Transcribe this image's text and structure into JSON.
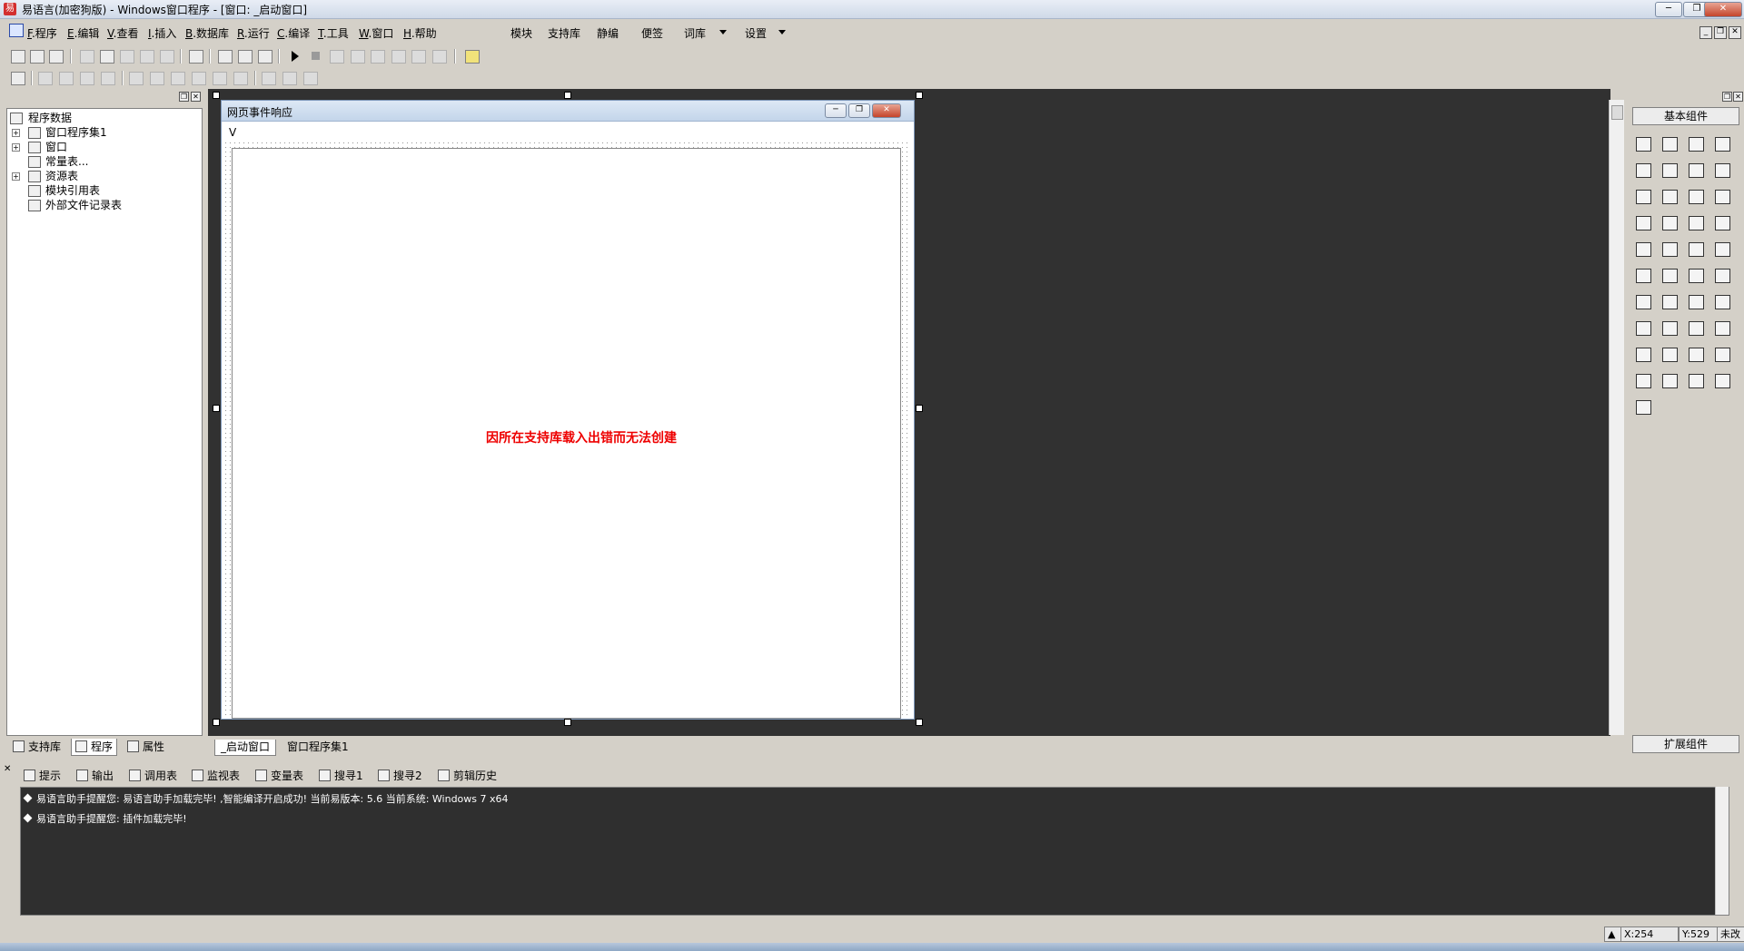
{
  "window": {
    "title": "易语言(加密狗版) - Windows窗口程序 - [窗口: _启动窗口]",
    "controls": [
      "─",
      "❐",
      "✕"
    ]
  },
  "menu": {
    "items": [
      {
        "key": "F",
        "label": ".程序"
      },
      {
        "key": "E",
        "label": ".编辑"
      },
      {
        "key": "V",
        "label": ".查看"
      },
      {
        "key": "I",
        "label": ".插入"
      },
      {
        "key": "B",
        "label": ".数据库"
      },
      {
        "key": "R",
        "label": ".运行"
      },
      {
        "key": "C",
        "label": ".编译"
      },
      {
        "key": "T",
        "label": ".工具"
      },
      {
        "key": "W",
        "label": ".窗口"
      },
      {
        "key": "H",
        "label": ".帮助"
      }
    ],
    "extras": [
      "模块",
      "支持库",
      "静编",
      "便签",
      "词库",
      "设置"
    ]
  },
  "left_panel": {
    "tree": [
      {
        "label": "程序数据",
        "icon": "database-icon",
        "expander": false,
        "indent": 0
      },
      {
        "label": "窗口程序集1",
        "icon": "module-icon",
        "expander": true,
        "indent": 1
      },
      {
        "label": "窗口",
        "icon": "window-icon",
        "expander": true,
        "indent": 1
      },
      {
        "label": "常量表...",
        "icon": "constant-icon",
        "expander": false,
        "indent": 1
      },
      {
        "label": "资源表",
        "icon": "resource-icon",
        "expander": true,
        "indent": 1
      },
      {
        "label": "模块引用表",
        "icon": "module-ref-icon",
        "expander": false,
        "indent": 1
      },
      {
        "label": "外部文件记录表",
        "icon": "file-icon",
        "expander": false,
        "indent": 1
      }
    ],
    "tabs": [
      "支持库",
      "程序",
      "属性"
    ]
  },
  "designer": {
    "window_title": "网页事件响应",
    "menu_marker": "V",
    "error_message": "因所在支持库载入出错而无法创建"
  },
  "editor_tabs": [
    "_启动窗口",
    "窗口程序集1"
  ],
  "right_panel": {
    "header": "基本组件",
    "footer": "扩展组件",
    "components": [
      "pointer-icon",
      "label-icon",
      "picture-icon",
      "shape-icon",
      "edit-icon",
      "group-icon",
      "text-icon",
      "line-icon",
      "checkbox-icon",
      "radio-icon",
      "list-icon",
      "listbox-icon",
      "table-icon",
      "progress-icon",
      "scrollbar-icon",
      "slider-icon",
      "ruler-icon",
      "tab-icon",
      "spin-icon",
      "image-box-icon",
      "calendar-icon",
      "date-icon",
      "dir-icon",
      "file-box-icon",
      "color-icon",
      "printer-icon",
      "split-icon",
      "toolbar-icon",
      "timer-icon",
      "print-icon",
      "transfer-icon",
      "network-icon",
      "socket-icon",
      "client-icon",
      "panel-icon",
      "status-icon",
      "database-icon",
      "data-source-icon",
      "chart-icon",
      "odbc-icon",
      "odbc-db-icon"
    ]
  },
  "output": {
    "tabs": [
      "提示",
      "输出",
      "调用表",
      "监视表",
      "变量表",
      "搜寻1",
      "搜寻2",
      "剪辑历史"
    ],
    "lines": [
      "易语言助手提醒您: 易语言助手加载完毕! ,智能编译开启成功! 当前易版本: 5.6 当前系统: Windows 7 x64",
      "易语言助手提醒您: 插件加载完毕!"
    ]
  },
  "status": {
    "x": "X:254",
    "y": "Y:529",
    "state": "未改"
  },
  "colors": {
    "editor_bg": "#313131",
    "error_text": "#e00000",
    "chrome": "#d4d0c8"
  }
}
